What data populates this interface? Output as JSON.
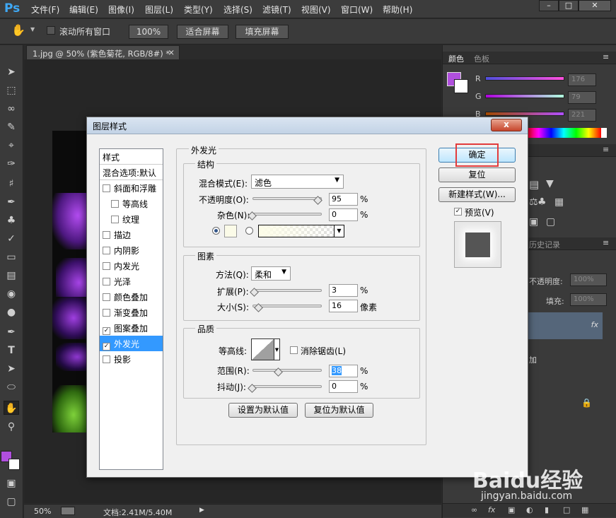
{
  "app": {
    "logo": "Ps"
  },
  "menu": [
    "文件(F)",
    "编辑(E)",
    "图像(I)",
    "图层(L)",
    "类型(Y)",
    "选择(S)",
    "滤镜(T)",
    "视图(V)",
    "窗口(W)",
    "帮助(H)"
  ],
  "options_bar": {
    "scroll_all": "滚动所有窗口",
    "zoom_100": "100%",
    "fit_screen": "适合屏幕",
    "fill_screen": "填充屏幕"
  },
  "document": {
    "tab_title": "1.jpg @ 50% (紫色菊花, RGB/8#) *",
    "zoom": "50%",
    "doc_info": "文档:2.41M/5.40M"
  },
  "color_panel": {
    "tab_color": "颜色",
    "tab_swatches": "色板",
    "r_label": "R",
    "g_label": "G",
    "b_label": "B",
    "r": "176",
    "g": "79",
    "b": "221",
    "fg_color": "#b04fdd"
  },
  "layers_panel": {
    "history_tab": "历史记录",
    "opacity_label": "不透明度:",
    "opacity": "100%",
    "fill_label": "填充:",
    "fill": "100%",
    "fx": "fx",
    "effect": "加"
  },
  "dialog": {
    "title": "图层样式",
    "close": "x",
    "styles_header": "样式",
    "blend_options": "混合选项:默认",
    "styles": [
      {
        "label": "斜面和浮雕",
        "checked": false,
        "indent": false
      },
      {
        "label": "等高线",
        "checked": false,
        "indent": true
      },
      {
        "label": "纹理",
        "checked": false,
        "indent": true
      },
      {
        "label": "描边",
        "checked": false,
        "indent": false
      },
      {
        "label": "内阴影",
        "checked": false,
        "indent": false
      },
      {
        "label": "内发光",
        "checked": false,
        "indent": false
      },
      {
        "label": "光泽",
        "checked": false,
        "indent": false
      },
      {
        "label": "颜色叠加",
        "checked": false,
        "indent": false
      },
      {
        "label": "渐变叠加",
        "checked": false,
        "indent": false
      },
      {
        "label": "图案叠加",
        "checked": true,
        "indent": false
      },
      {
        "label": "外发光",
        "checked": true,
        "indent": false,
        "selected": true
      },
      {
        "label": "投影",
        "checked": false,
        "indent": false
      }
    ],
    "section_title": "外发光",
    "structure": {
      "title": "结构",
      "blend_mode_label": "混合模式(E):",
      "blend_mode": "滤色",
      "opacity_label": "不透明度(O):",
      "opacity": "95",
      "noise_label": "杂色(N):",
      "noise": "0",
      "percent": "%"
    },
    "elements": {
      "title": "图素",
      "method_label": "方法(Q):",
      "method": "柔和",
      "spread_label": "扩展(P):",
      "spread": "3",
      "size_label": "大小(S):",
      "size": "16",
      "percent": "%",
      "pixels": "像素"
    },
    "quality": {
      "title": "品质",
      "contour_label": "等高线:",
      "antialias_label": "消除锯齿(L)",
      "range_label": "范围(R):",
      "range": "38",
      "jitter_label": "抖动(J):",
      "jitter": "0",
      "percent": "%"
    },
    "set_default": "设置为默认值",
    "reset_default": "复位为默认值",
    "ok": "确定",
    "reset": "复位",
    "new_style": "新建样式(W)...",
    "preview_label": "预览(V)"
  },
  "watermark": {
    "brand": "Baidu经验",
    "url": "jingyan.baidu.com"
  }
}
